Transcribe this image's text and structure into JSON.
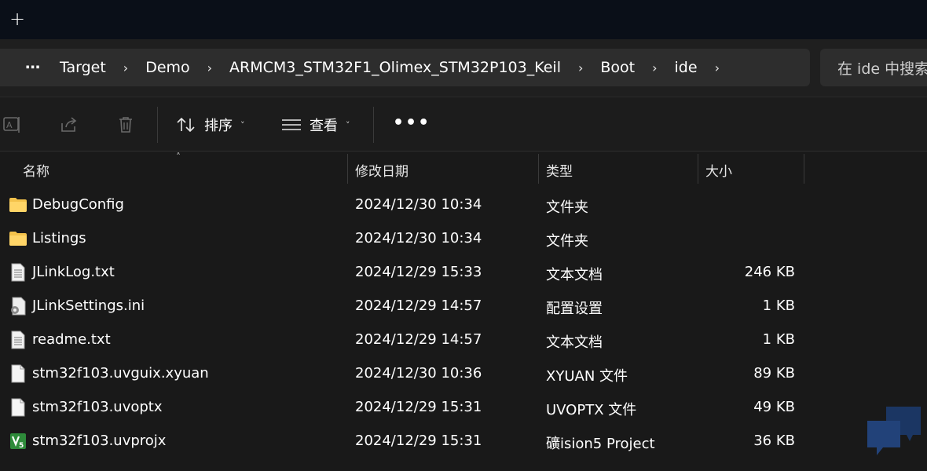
{
  "tabbar": {
    "new_tab_label": "+"
  },
  "breadcrumb": {
    "more_label": "⋯",
    "items": [
      "Target",
      "Demo",
      "ARMCM3_STM32F1_Olimex_STM32P103_Keil",
      "Boot",
      "ide"
    ],
    "separator": "›"
  },
  "search": {
    "placeholder": "在 ide 中搜索"
  },
  "toolbar": {
    "sort_label": "排序",
    "view_label": "查看",
    "more_label": "•••",
    "chevron": "˅"
  },
  "columns": {
    "name": "名称",
    "date": "修改日期",
    "type": "类型",
    "size": "大小",
    "sort_indicator": "˄"
  },
  "files": [
    {
      "icon": "folder-icon",
      "name": "DebugConfig",
      "date": "2024/12/30 10:34",
      "type": "文件夹",
      "size": ""
    },
    {
      "icon": "folder-icon",
      "name": "Listings",
      "date": "2024/12/30 10:34",
      "type": "文件夹",
      "size": ""
    },
    {
      "icon": "text-file-icon",
      "name": "JLinkLog.txt",
      "date": "2024/12/29 15:33",
      "type": "文本文档",
      "size": "246 KB"
    },
    {
      "icon": "settings-file-icon",
      "name": "JLinkSettings.ini",
      "date": "2024/12/29 14:57",
      "type": "配置设置",
      "size": "1 KB"
    },
    {
      "icon": "text-file-icon",
      "name": "readme.txt",
      "date": "2024/12/29 14:57",
      "type": "文本文档",
      "size": "1 KB"
    },
    {
      "icon": "blank-file-icon",
      "name": "stm32f103.uvguix.xyuan",
      "date": "2024/12/30 10:36",
      "type": "XYUAN 文件",
      "size": "89 KB"
    },
    {
      "icon": "blank-file-icon",
      "name": "stm32f103.uvoptx",
      "date": "2024/12/29 15:31",
      "type": "UVOPTX 文件",
      "size": "49 KB"
    },
    {
      "icon": "keil-project-icon",
      "name": "stm32f103.uvprojx",
      "date": "2024/12/29 15:31",
      "type": "礦ision5 Project",
      "size": "36 KB"
    }
  ],
  "colors": {
    "background": "#191919",
    "folder": "#f4c24b",
    "keil_green": "#2e8b3a"
  }
}
